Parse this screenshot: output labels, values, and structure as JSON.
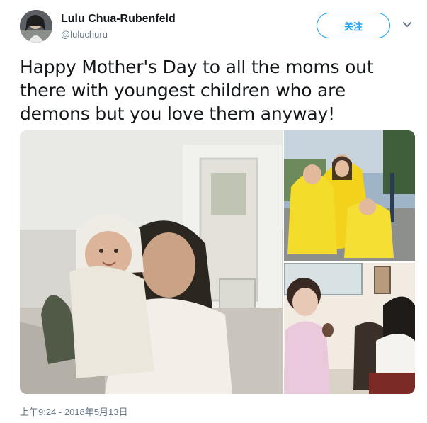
{
  "author": {
    "name": "Lulu Chua-Rubenfeld",
    "handle": "@luluchuru"
  },
  "follow_label": "关注",
  "tweet": {
    "text": "Happy Mother's Day to all the moms out there with youngest children who are demons but you love them anyway!"
  },
  "media": [
    {
      "icon": "photo-mother-holding-baby"
    },
    {
      "icon": "photo-children-in-yellow-raincoats"
    },
    {
      "icon": "photo-child-at-table"
    }
  ],
  "timestamp": "上午9:24 - 2018年5月13日",
  "colors": {
    "accent": "#1da1f2",
    "muted": "#657786",
    "text": "#14171a"
  }
}
